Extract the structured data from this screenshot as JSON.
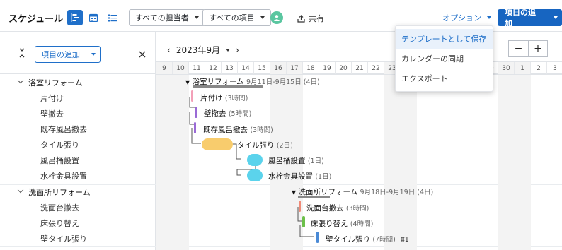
{
  "header": {
    "title": "スケジュール",
    "assignee_filter": "すべての担当者",
    "item_filter": "すべての項目",
    "share_label": "共有",
    "options_label": "オプション",
    "add_item_label": "項目の追加"
  },
  "left_panel": {
    "add_item_label": "項目の追加",
    "groups": [
      {
        "name": "浴室リフォーム",
        "tasks": [
          "片付け",
          "壁撤去",
          "既存風呂撤去",
          "タイル張り",
          "風呂桶設置",
          "水栓金具設置"
        ]
      },
      {
        "name": "洗面所リフォーム",
        "tasks": [
          "洗面台撤去",
          "床張り替え",
          "壁タイル張り"
        ]
      }
    ]
  },
  "timeline": {
    "month_label": "2023年9月",
    "days": [
      "9",
      "10",
      "11",
      "12",
      "13",
      "14",
      "15",
      "16",
      "17",
      "18",
      "19",
      "20",
      "21",
      "22",
      "23",
      "24",
      "25",
      "26",
      "27",
      "28",
      "29",
      "30",
      "1",
      "2",
      "3",
      "4"
    ],
    "zoom_out": "−",
    "zoom_in": "+"
  },
  "gantt": {
    "group1": {
      "name": "浴室リフォーム",
      "range": "9月11日-9月15日 (4日)"
    },
    "group2": {
      "name": "洗面所リフォーム",
      "range": "9月18日-9月19日 (4日)"
    },
    "bars": [
      {
        "name": "片付け",
        "duration": "(3時間)"
      },
      {
        "name": "壁撤去",
        "duration": "(5時間)"
      },
      {
        "name": "既存風呂撤去",
        "duration": "(3時間)"
      },
      {
        "name": "タイル張り",
        "duration": "(2日)"
      },
      {
        "name": "風呂桶設置",
        "duration": "(1日)"
      },
      {
        "name": "水栓金具設置",
        "duration": "(1日)"
      },
      {
        "name": "洗面台撤去",
        "duration": "(3時間)"
      },
      {
        "name": "床張り替え",
        "duration": "(4時間)"
      },
      {
        "name": "壁タイル張り",
        "duration": "(7時間)",
        "subtasks": "1"
      }
    ],
    "colors": {
      "pink": "#f3a0b8",
      "purple": "#9a6ad6",
      "yellow": "#f8cc6d",
      "cyan": "#5bd3ec",
      "salmon": "#f08b78",
      "green": "#6cc04a",
      "blue": "#4a8ad6",
      "summary": "#888888"
    }
  },
  "options_menu": {
    "items": [
      "テンプレートとして保存",
      "カレンダーの同期",
      "エクスポート"
    ]
  }
}
